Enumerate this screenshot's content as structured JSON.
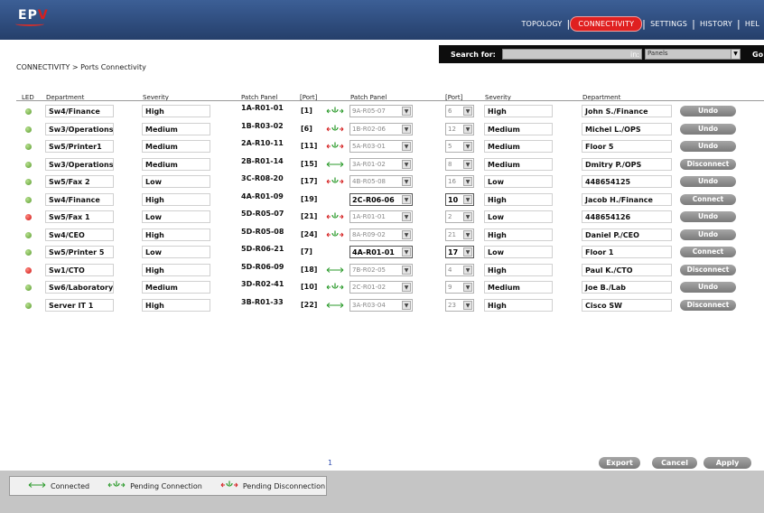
{
  "header": {
    "logo": {
      "left": "EP",
      "right": "V"
    },
    "nav": [
      {
        "label": "TOPOLOGY",
        "active": false
      },
      {
        "label": "CONNECTIVITY",
        "active": true
      },
      {
        "label": "SETTINGS",
        "active": false
      },
      {
        "label": "HISTORY",
        "active": false
      },
      {
        "label": "HEL",
        "active": false
      }
    ]
  },
  "search": {
    "label": "Search for:",
    "value": "",
    "in_label": "in:",
    "in_value": "Panels",
    "go_label": "Go"
  },
  "breadcrumb": "CONNECTIVITY > Ports Connectivity",
  "columns": {
    "led": "LED",
    "department": "Department",
    "severity": "Severity",
    "patch_panel": "Patch Panel",
    "port": "[Port]",
    "patch_panel_2": "Patch Panel",
    "port_2": "[Port]",
    "severity_2": "Severity",
    "department_2": "Department"
  },
  "rows": [
    {
      "led": "green",
      "department": "Sw4/Finance",
      "severity": "High",
      "patch_panel": "1A-R01-01",
      "port": "[1]",
      "status": "pending-connection",
      "patch_panel_2": "9A-R05-07",
      "port_2": "6",
      "editable": false,
      "severity_2": "High",
      "department_2": "John S./Finance",
      "action": "Undo"
    },
    {
      "led": "green",
      "department": "Sw3/Operations",
      "severity": "Medium",
      "patch_panel": "1B-R03-02",
      "port": "[6]",
      "status": "pending-disconnection",
      "patch_panel_2": "1B-R02-06",
      "port_2": "12",
      "editable": false,
      "severity_2": "Medium",
      "department_2": "Michel L./OPS",
      "action": "Undo"
    },
    {
      "led": "green",
      "department": "Sw5/Printer1",
      "severity": "Medium",
      "patch_panel": "2A-R10-11",
      "port": "[11]",
      "status": "pending-disconnection",
      "patch_panel_2": "5A-R03-01",
      "port_2": "5",
      "editable": false,
      "severity_2": "Medium",
      "department_2": "Floor 5",
      "action": "Undo"
    },
    {
      "led": "green",
      "department": "Sw3/Operations",
      "severity": "Medium",
      "patch_panel": "2B-R01-14",
      "port": "[15]",
      "status": "connected",
      "patch_panel_2": "3A-R01-02",
      "port_2": "8",
      "editable": false,
      "severity_2": "Medium",
      "department_2": "Dmitry P./OPS",
      "action": "Disconnect"
    },
    {
      "led": "green",
      "department": "Sw5/Fax 2",
      "severity": "Low",
      "patch_panel": "3C-R08-20",
      "port": "[17]",
      "status": "pending-disconnection",
      "patch_panel_2": "4B-R05-08",
      "port_2": "16",
      "editable": false,
      "severity_2": "Low",
      "department_2": "448654125",
      "action": "Undo"
    },
    {
      "led": "green",
      "department": "Sw4/Finance",
      "severity": "High",
      "patch_panel": "4A-R01-09",
      "port": "[19]",
      "status": "none",
      "patch_panel_2": "2C-R06-06",
      "port_2": "10",
      "editable": true,
      "severity_2": "High",
      "department_2": "Jacob H./Finance",
      "action": "Connect"
    },
    {
      "led": "red",
      "department": "Sw5/Fax 1",
      "severity": "Low",
      "patch_panel": "5D-R05-07",
      "port": "[21]",
      "status": "pending-disconnection",
      "patch_panel_2": "1A-R01-01",
      "port_2": "2",
      "editable": false,
      "severity_2": "Low",
      "department_2": "448654126",
      "action": "Undo"
    },
    {
      "led": "green",
      "department": "Sw4/CEO",
      "severity": "High",
      "patch_panel": "5D-R05-08",
      "port": "[24]",
      "status": "pending-disconnection",
      "patch_panel_2": "8A-R09-02",
      "port_2": "21",
      "editable": false,
      "severity_2": "High",
      "department_2": "Daniel P./CEO",
      "action": "Undo"
    },
    {
      "led": "green",
      "department": "Sw5/Printer 5",
      "severity": "Low",
      "patch_panel": "5D-R06-21",
      "port": "[7]",
      "status": "none",
      "patch_panel_2": "4A-R01-01",
      "port_2": "17",
      "editable": true,
      "severity_2": "Low",
      "department_2": "Floor 1",
      "action": "Connect"
    },
    {
      "led": "red",
      "department": "Sw1/CTO",
      "severity": "High",
      "patch_panel": "5D-R06-09",
      "port": "[18]",
      "status": "connected",
      "patch_panel_2": "7B-R02-05",
      "port_2": "4",
      "editable": false,
      "severity_2": "High",
      "department_2": "Paul K./CTO",
      "action": "Disconnect"
    },
    {
      "led": "green",
      "department": "Sw6/Laboratory",
      "severity": "Medium",
      "patch_panel": "3D-R02-41",
      "port": "[10]",
      "status": "pending-connection",
      "patch_panel_2": "2C-R01-02",
      "port_2": "9",
      "editable": false,
      "severity_2": "Medium",
      "department_2": "Joe B./Lab",
      "action": "Undo"
    },
    {
      "led": "green",
      "department": "Server IT 1",
      "severity": "High",
      "patch_panel": "3B-R01-33",
      "port": "[22]",
      "status": "connected",
      "patch_panel_2": "3A-R03-04",
      "port_2": "23",
      "editable": false,
      "severity_2": "High",
      "department_2": "Cisco SW",
      "action": "Disconnect"
    }
  ],
  "page_number": "1",
  "buttons": {
    "export": "Export",
    "cancel": "Cancel",
    "apply": "Apply"
  },
  "legend": {
    "connected": "Connected",
    "pending_connection": "Pending Connection",
    "pending_disconnection": "Pending Disconnection"
  },
  "colors": {
    "header": "#2e4d80",
    "active_tab": "#e02020",
    "connected_arrow": "#2a9a2a",
    "pending_red": "#d42020",
    "button_gray": "#8f8f8f"
  },
  "icons": {
    "connected": "double-arrow-icon",
    "pending_connection": "green-plug-arrow-icon",
    "pending_disconnection": "red-plug-arrow-icon"
  }
}
